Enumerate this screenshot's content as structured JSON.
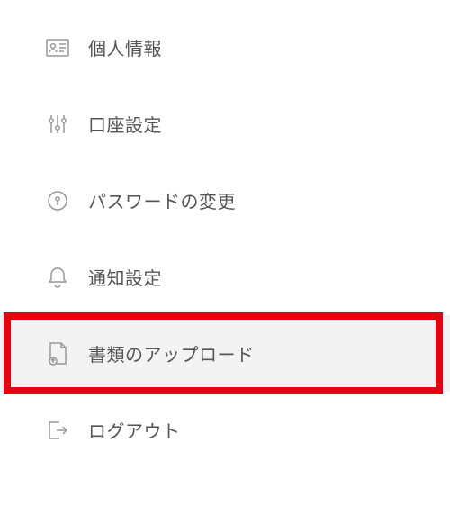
{
  "menu": {
    "items": [
      {
        "id": "personal-info",
        "label": "個人情報",
        "icon": "id-card-icon",
        "active": false,
        "highlighted": false
      },
      {
        "id": "account-settings",
        "label": "口座設定",
        "icon": "sliders-icon",
        "active": false,
        "highlighted": false
      },
      {
        "id": "password-change",
        "label": "パスワードの変更",
        "icon": "lock-icon",
        "active": false,
        "highlighted": false
      },
      {
        "id": "notification-settings",
        "label": "通知設定",
        "icon": "bell-icon",
        "active": false,
        "highlighted": false
      },
      {
        "id": "document-upload",
        "label": "書類のアップロード",
        "icon": "document-upload-icon",
        "active": true,
        "highlighted": true
      },
      {
        "id": "logout",
        "label": "ログアウト",
        "icon": "logout-icon",
        "active": false,
        "highlighted": false
      }
    ]
  },
  "colors": {
    "highlight_border": "#e60012",
    "active_bg": "#f3f3f3",
    "icon": "#999999",
    "text": "#555555"
  }
}
